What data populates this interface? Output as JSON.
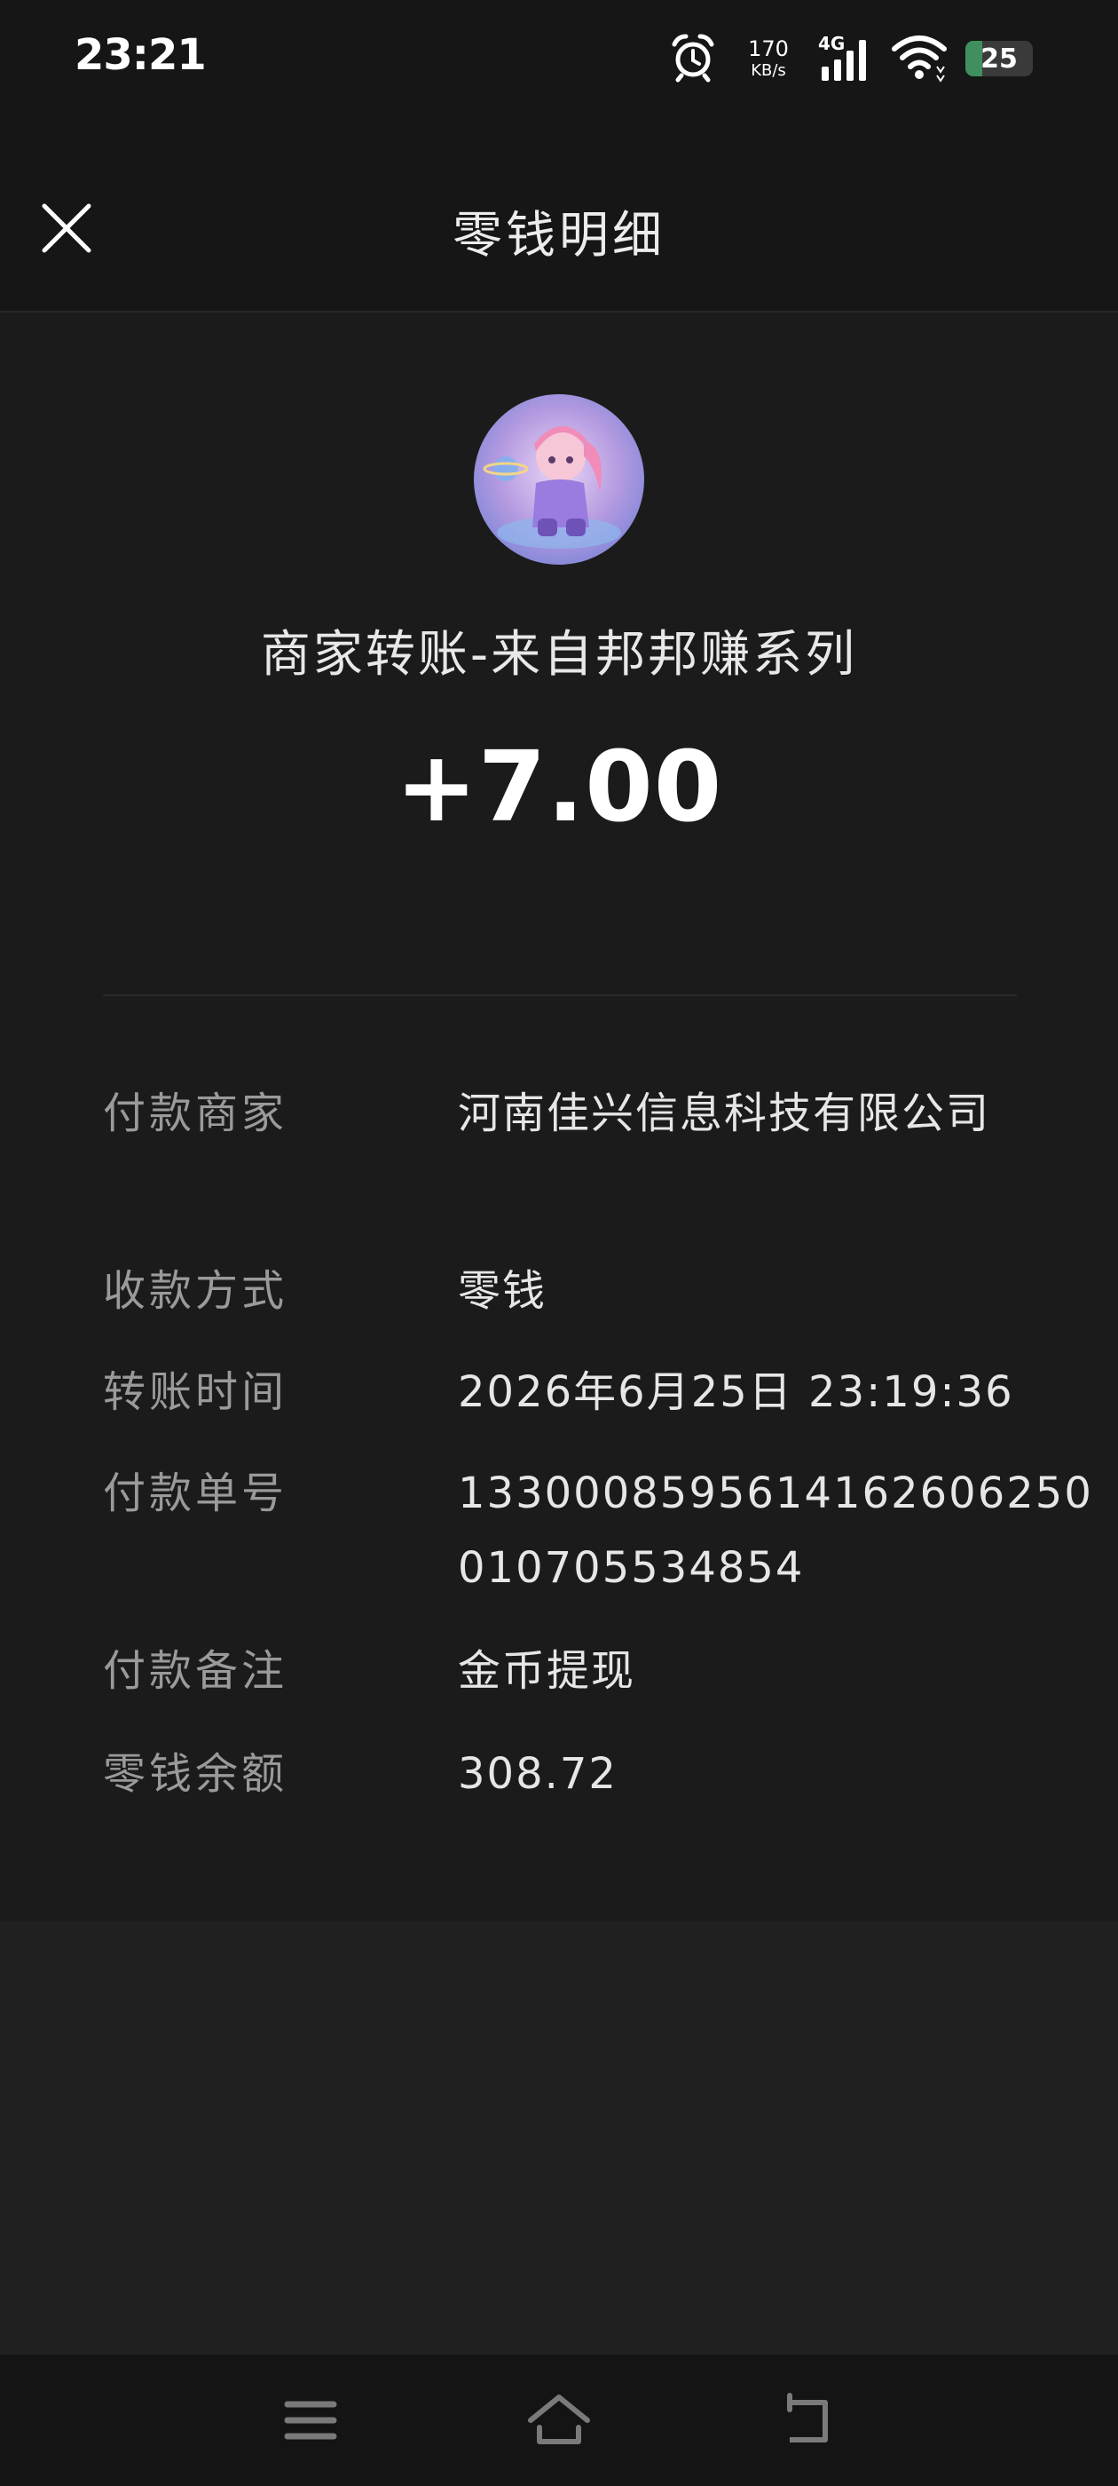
{
  "status_bar": {
    "time": "23:21",
    "net_speed_value": "170",
    "net_speed_unit": "KB/s",
    "network_type": "4G",
    "battery": "25",
    "battery_level": 0.25,
    "battery_color": "#3f8f5f"
  },
  "header": {
    "title": "零钱明细"
  },
  "transaction": {
    "merchant_title": "商家转账-来自邦邦赚系列",
    "amount": "+7.00"
  },
  "details": [
    {
      "label": "付款商家",
      "value": "河南佳兴信息科技有限公司"
    },
    {
      "label": "收款方式",
      "value": "零钱"
    },
    {
      "label": "转账时间",
      "value": "2026年6月25日 23:19:36"
    },
    {
      "label": "付款单号",
      "value": "133000859561416260625001070553485‌4"
    },
    {
      "label": "付款备注",
      "value": "金币提现"
    },
    {
      "label": "零钱余额",
      "value": "308.72"
    }
  ],
  "icons": {
    "close": "close-icon",
    "avatar": "merchant-avatar",
    "nav_menu": "menu-icon",
    "nav_home": "home-icon",
    "nav_back": "back-icon"
  }
}
